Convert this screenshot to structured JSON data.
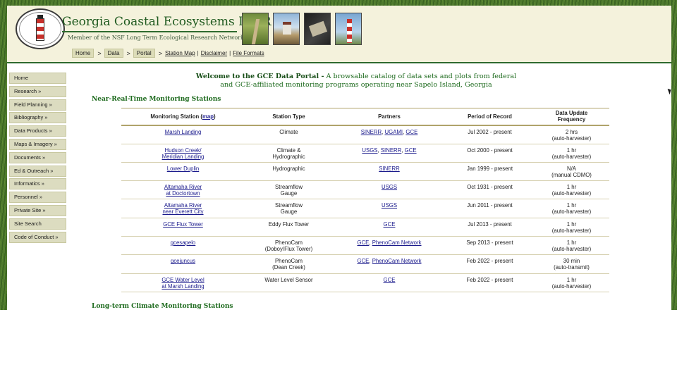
{
  "header": {
    "logo_text": "Georgia Coastal Ecosystems LTER",
    "title": "Georgia Coastal Ecosystems LTER",
    "subtitle": "Member of the NSF Long Term Ecological Research Network",
    "photos": [
      "marsh-boardwalk",
      "field-station",
      "instrument",
      "sapelo-lighthouse"
    ]
  },
  "breadcrumb": {
    "items": [
      "Home",
      "Data",
      "Portal"
    ],
    "separator": ">",
    "links": [
      "Station Map",
      "Disclaimer",
      "File Formats"
    ],
    "link_separator": "|"
  },
  "sidebar": {
    "items": [
      {
        "label": "Home"
      },
      {
        "label": "Research »"
      },
      {
        "label": "Field Planning »"
      },
      {
        "label": "Bibliography »"
      },
      {
        "label": "Data Products »"
      },
      {
        "label": "Maps & Imagery »"
      },
      {
        "label": "Documents »"
      },
      {
        "label": "Ed & Outreach »"
      },
      {
        "label": "Informatics »"
      },
      {
        "label": "Personnel »"
      },
      {
        "label": "Private Site »"
      },
      {
        "label": "Site Search"
      },
      {
        "label": "Code of Conduct »"
      }
    ]
  },
  "welcome": {
    "bold": "Welcome to the GCE Data Portal -",
    "line1": "A browsable catalog of data sets and plots from federal",
    "line2": "and GCE-affiliated monitoring programs operating near Sapelo Island, Georgia"
  },
  "sections": {
    "near_real_time": "Near-Real-Time Monitoring Stations",
    "long_term": "Long-term Climate Monitoring Stations"
  },
  "table": {
    "headers": {
      "station": "Monitoring Station (",
      "station_map": "map",
      "station_close": ")",
      "type": "Station Type",
      "partners": "Partners",
      "period": "Period of Record",
      "frequency_1": "Data Update",
      "frequency_2": "Frequency"
    },
    "rows": [
      {
        "station": [
          "Marsh Landing",
          ""
        ],
        "type": [
          "Climate",
          ""
        ],
        "partners": [
          "SINERR",
          "UGAMI",
          "GCE"
        ],
        "period": "Jul 2002 - present",
        "freq": [
          "2 hrs",
          "(auto-harvester)"
        ]
      },
      {
        "station": [
          "Hudson Creek/",
          "Meridian Landing"
        ],
        "type": [
          "Climate &",
          "Hydrographic"
        ],
        "partners": [
          "USGS",
          "SINERR",
          "GCE"
        ],
        "period": "Oct 2000 - present",
        "freq": [
          "1 hr",
          "(auto-harvester)"
        ]
      },
      {
        "station": [
          "Lower Duplin",
          ""
        ],
        "type": [
          "Hydrographic",
          ""
        ],
        "partners": [
          "SINERR"
        ],
        "period": "Jan 1999 - present",
        "freq": [
          "N/A",
          "(manual CDMO)"
        ]
      },
      {
        "station": [
          "Altamaha River",
          "at Doctortown"
        ],
        "type": [
          "Streamflow",
          "Gauge"
        ],
        "partners": [
          "USGS"
        ],
        "period": "Oct 1931 - present",
        "freq": [
          "1 hr",
          "(auto-harvester)"
        ]
      },
      {
        "station": [
          "Altamaha River",
          "near Everett City"
        ],
        "type": [
          "Streamflow",
          "Gauge"
        ],
        "partners": [
          "USGS"
        ],
        "period": "Jun 2011 - present",
        "freq": [
          "1 hr",
          "(auto-harvester)"
        ]
      },
      {
        "station": [
          "GCE Flux Tower",
          ""
        ],
        "type": [
          "Eddy Flux Tower",
          ""
        ],
        "partners": [
          "GCE"
        ],
        "period": "Jul 2013 - present",
        "freq": [
          "1 hr",
          "(auto-harvester)"
        ]
      },
      {
        "station": [
          "gcesapelo",
          ""
        ],
        "type": [
          "PhenoCam",
          "(Doboy/Flux Tower)"
        ],
        "partners": [
          "GCE",
          "PhenoCam Network"
        ],
        "period": "Sep 2013 - present",
        "freq": [
          "1 hr",
          "(auto-harvester)"
        ]
      },
      {
        "station": [
          "gcejuncus",
          ""
        ],
        "type": [
          "PhenoCam",
          "(Dean Creek)"
        ],
        "partners": [
          "GCE",
          "PhenoCam Network"
        ],
        "period": "Feb 2022 - present",
        "freq": [
          "30 min",
          "(auto-transmit)"
        ]
      },
      {
        "station": [
          "GCE Water Level",
          "at Marsh Landing"
        ],
        "type": [
          "Water Level Sensor",
          ""
        ],
        "partners": [
          "GCE"
        ],
        "period": "Feb 2022 - present",
        "freq": [
          "1 hr",
          "(auto-harvester)"
        ]
      }
    ]
  }
}
